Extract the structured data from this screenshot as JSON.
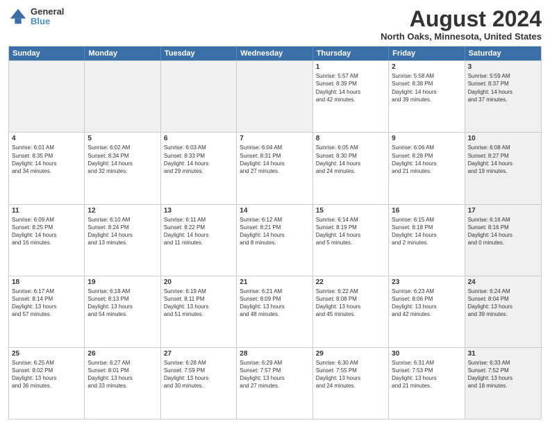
{
  "header": {
    "logo_line1": "General",
    "logo_line2": "Blue",
    "month": "August 2024",
    "location": "North Oaks, Minnesota, United States"
  },
  "weekdays": [
    "Sunday",
    "Monday",
    "Tuesday",
    "Wednesday",
    "Thursday",
    "Friday",
    "Saturday"
  ],
  "weeks": [
    [
      {
        "day": "",
        "info": "",
        "shaded": true
      },
      {
        "day": "",
        "info": "",
        "shaded": true
      },
      {
        "day": "",
        "info": "",
        "shaded": true
      },
      {
        "day": "",
        "info": "",
        "shaded": true
      },
      {
        "day": "1",
        "info": "Sunrise: 5:57 AM\nSunset: 8:39 PM\nDaylight: 14 hours\nand 42 minutes.",
        "shaded": false
      },
      {
        "day": "2",
        "info": "Sunrise: 5:58 AM\nSunset: 8:38 PM\nDaylight: 14 hours\nand 39 minutes.",
        "shaded": false
      },
      {
        "day": "3",
        "info": "Sunrise: 5:59 AM\nSunset: 8:37 PM\nDaylight: 14 hours\nand 37 minutes.",
        "shaded": true
      }
    ],
    [
      {
        "day": "4",
        "info": "Sunrise: 6:01 AM\nSunset: 8:35 PM\nDaylight: 14 hours\nand 34 minutes.",
        "shaded": false
      },
      {
        "day": "5",
        "info": "Sunrise: 6:02 AM\nSunset: 8:34 PM\nDaylight: 14 hours\nand 32 minutes.",
        "shaded": false
      },
      {
        "day": "6",
        "info": "Sunrise: 6:03 AM\nSunset: 8:33 PM\nDaylight: 14 hours\nand 29 minutes.",
        "shaded": false
      },
      {
        "day": "7",
        "info": "Sunrise: 6:04 AM\nSunset: 8:31 PM\nDaylight: 14 hours\nand 27 minutes.",
        "shaded": false
      },
      {
        "day": "8",
        "info": "Sunrise: 6:05 AM\nSunset: 8:30 PM\nDaylight: 14 hours\nand 24 minutes.",
        "shaded": false
      },
      {
        "day": "9",
        "info": "Sunrise: 6:06 AM\nSunset: 8:28 PM\nDaylight: 14 hours\nand 21 minutes.",
        "shaded": false
      },
      {
        "day": "10",
        "info": "Sunrise: 6:08 AM\nSunset: 8:27 PM\nDaylight: 14 hours\nand 19 minutes.",
        "shaded": true
      }
    ],
    [
      {
        "day": "11",
        "info": "Sunrise: 6:09 AM\nSunset: 8:25 PM\nDaylight: 14 hours\nand 16 minutes.",
        "shaded": false
      },
      {
        "day": "12",
        "info": "Sunrise: 6:10 AM\nSunset: 8:24 PM\nDaylight: 14 hours\nand 13 minutes.",
        "shaded": false
      },
      {
        "day": "13",
        "info": "Sunrise: 6:11 AM\nSunset: 8:22 PM\nDaylight: 14 hours\nand 11 minutes.",
        "shaded": false
      },
      {
        "day": "14",
        "info": "Sunrise: 6:12 AM\nSunset: 8:21 PM\nDaylight: 14 hours\nand 8 minutes.",
        "shaded": false
      },
      {
        "day": "15",
        "info": "Sunrise: 6:14 AM\nSunset: 8:19 PM\nDaylight: 14 hours\nand 5 minutes.",
        "shaded": false
      },
      {
        "day": "16",
        "info": "Sunrise: 6:15 AM\nSunset: 8:18 PM\nDaylight: 14 hours\nand 2 minutes.",
        "shaded": false
      },
      {
        "day": "17",
        "info": "Sunrise: 6:16 AM\nSunset: 8:16 PM\nDaylight: 14 hours\nand 0 minutes.",
        "shaded": true
      }
    ],
    [
      {
        "day": "18",
        "info": "Sunrise: 6:17 AM\nSunset: 8:14 PM\nDaylight: 13 hours\nand 57 minutes.",
        "shaded": false
      },
      {
        "day": "19",
        "info": "Sunrise: 6:18 AM\nSunset: 8:13 PM\nDaylight: 13 hours\nand 54 minutes.",
        "shaded": false
      },
      {
        "day": "20",
        "info": "Sunrise: 6:19 AM\nSunset: 8:11 PM\nDaylight: 13 hours\nand 51 minutes.",
        "shaded": false
      },
      {
        "day": "21",
        "info": "Sunrise: 6:21 AM\nSunset: 8:09 PM\nDaylight: 13 hours\nand 48 minutes.",
        "shaded": false
      },
      {
        "day": "22",
        "info": "Sunrise: 6:22 AM\nSunset: 8:08 PM\nDaylight: 13 hours\nand 45 minutes.",
        "shaded": false
      },
      {
        "day": "23",
        "info": "Sunrise: 6:23 AM\nSunset: 8:06 PM\nDaylight: 13 hours\nand 42 minutes.",
        "shaded": false
      },
      {
        "day": "24",
        "info": "Sunrise: 6:24 AM\nSunset: 8:04 PM\nDaylight: 13 hours\nand 39 minutes.",
        "shaded": true
      }
    ],
    [
      {
        "day": "25",
        "info": "Sunrise: 6:25 AM\nSunset: 8:02 PM\nDaylight: 13 hours\nand 36 minutes.",
        "shaded": false
      },
      {
        "day": "26",
        "info": "Sunrise: 6:27 AM\nSunset: 8:01 PM\nDaylight: 13 hours\nand 33 minutes.",
        "shaded": false
      },
      {
        "day": "27",
        "info": "Sunrise: 6:28 AM\nSunset: 7:59 PM\nDaylight: 13 hours\nand 30 minutes.",
        "shaded": false
      },
      {
        "day": "28",
        "info": "Sunrise: 6:29 AM\nSunset: 7:57 PM\nDaylight: 13 hours\nand 27 minutes.",
        "shaded": false
      },
      {
        "day": "29",
        "info": "Sunrise: 6:30 AM\nSunset: 7:55 PM\nDaylight: 13 hours\nand 24 minutes.",
        "shaded": false
      },
      {
        "day": "30",
        "info": "Sunrise: 6:31 AM\nSunset: 7:53 PM\nDaylight: 13 hours\nand 21 minutes.",
        "shaded": false
      },
      {
        "day": "31",
        "info": "Sunrise: 6:33 AM\nSunset: 7:52 PM\nDaylight: 13 hours\nand 18 minutes.",
        "shaded": true
      }
    ]
  ]
}
